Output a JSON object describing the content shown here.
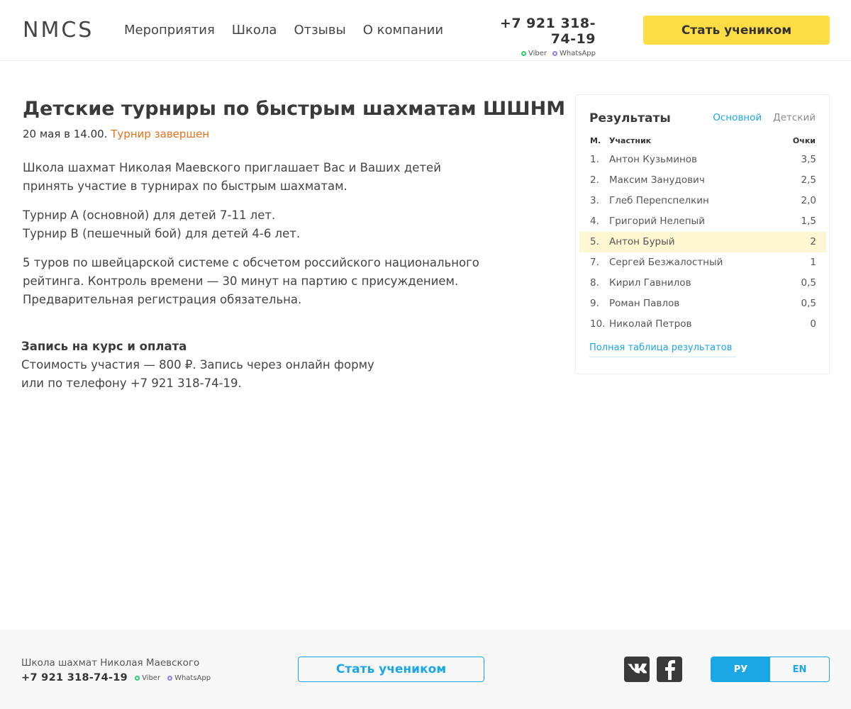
{
  "header": {
    "logo": "NMCS",
    "nav": [
      "Мероприятия",
      "Школа",
      "Отзывы",
      "О компании"
    ],
    "phone": "+7 921 318-74-19",
    "messengers": [
      "Viber",
      "WhatsApp"
    ],
    "cta": "Стать учеником"
  },
  "event": {
    "title": "Детские турниры по быстрым шахматам ШШНМ",
    "date": "20 мая в 14.00.",
    "status": "Турнир завершен",
    "para1_line1": "Школа шахмат Николая Маевского приглашает Вас и Ваших детей",
    "para1_line2": "принять участие в турнирах по быстрым шахматам.",
    "para2_line1": "Турнир А (основной) для детей 7-11 лет.",
    "para2_line2": "Турнир В (пешечный бой) для детей 4-6 лет.",
    "para3_line1": "5 туров по швейцарской системе с обсчетом российского национального",
    "para3_line2": "рейтинга. Контроль времени — 30 минут на партию с присуждением.",
    "para3_line3": "Предварительная регистрация обязательна.",
    "reg_title": "Запись на курс и оплата",
    "reg_line1": "Стоимость участия — 800 ₽. Запись через онлайн форму",
    "reg_line2": "или по телефону +7 921 318-74-19."
  },
  "results": {
    "title": "Результаты",
    "tabs": [
      {
        "label": "Основной",
        "active": true
      },
      {
        "label": "Детский",
        "active": false
      }
    ],
    "headers": {
      "place": "М.",
      "participant": "Участник",
      "points": "Очки"
    },
    "rows": [
      {
        "place": "1.",
        "name": "Антон Кузьминов",
        "points": "3,5",
        "highlight": false
      },
      {
        "place": "2.",
        "name": "Максим Занудович",
        "points": "2,5",
        "highlight": false
      },
      {
        "place": "3.",
        "name": "Глеб Перепспелкин",
        "points": "2,0",
        "highlight": false
      },
      {
        "place": "4.",
        "name": "Григорий Нелепый",
        "points": "1,5",
        "highlight": false
      },
      {
        "place": "5.",
        "name": "Антон Бурый",
        "points": "2",
        "highlight": true
      },
      {
        "place": "7.",
        "name": "Сергей Безжалостный",
        "points": "1",
        "highlight": false
      },
      {
        "place": "8.",
        "name": "Кирил Гавнилов",
        "points": "0,5",
        "highlight": false
      },
      {
        "place": "9.",
        "name": "Роман Павлов",
        "points": "0,5",
        "highlight": false
      },
      {
        "place": "10.",
        "name": "Николай Петров",
        "points": "0",
        "highlight": false
      }
    ],
    "full_link": "Полная таблица результатов"
  },
  "footer": {
    "school": "Школа шахмат Николая Маевского",
    "phone": "+7 921 318-74-19",
    "messengers": [
      "Viber",
      "WhatsApp"
    ],
    "cta": "Стать учеником",
    "social": [
      "vk-icon",
      "facebook-icon"
    ],
    "languages": [
      {
        "label": "РУ",
        "active": true
      },
      {
        "label": "EN",
        "active": false
      }
    ]
  },
  "colors": {
    "accent_yellow": "#ffdd44",
    "accent_blue": "#1ba6e6",
    "status_orange": "#e8701a",
    "highlight_row": "#fff7d1",
    "viber_dot": "#2ecc71",
    "whatsapp_dot": "#8e7cf0"
  }
}
